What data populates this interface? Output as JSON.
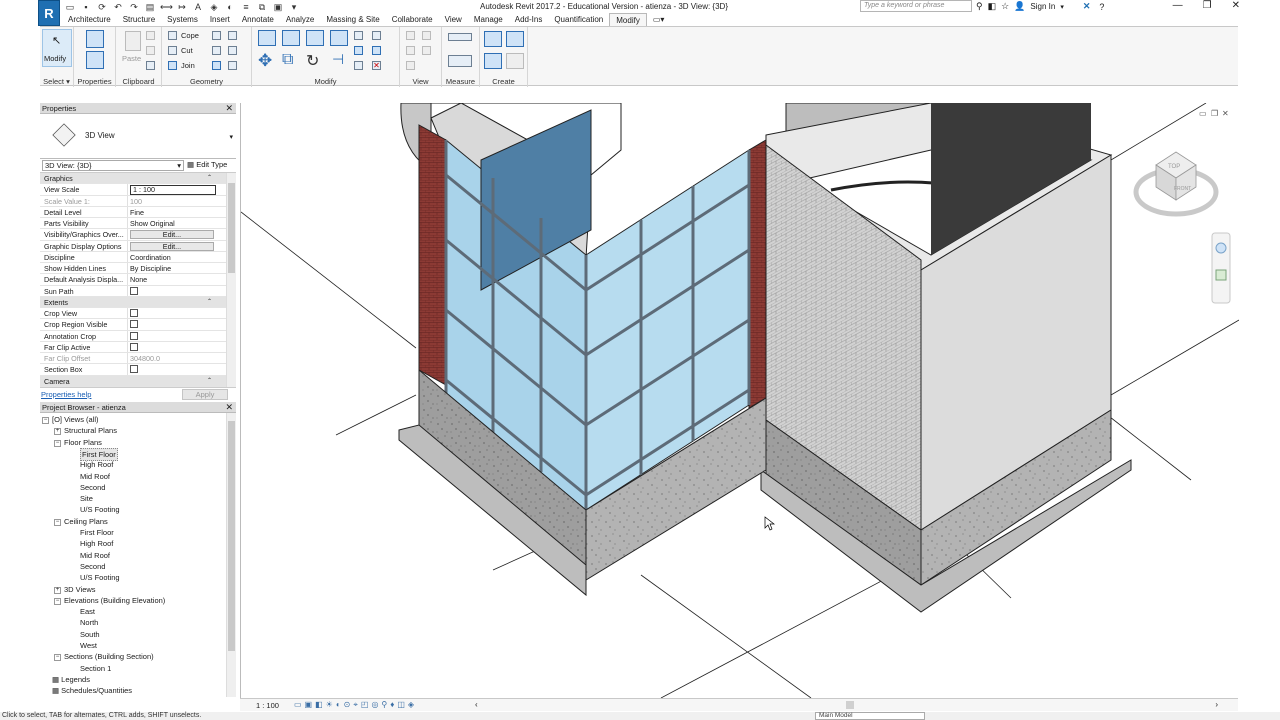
{
  "app": {
    "title": "Autodesk Revit 2017.2 - Educational Version -    atienza - 3D View: {3D}",
    "logo": "R",
    "search_placeholder": "Type a keyword or phrase",
    "sign_in": "Sign In"
  },
  "ribbon_tabs": [
    "Architecture",
    "Structure",
    "Systems",
    "Insert",
    "Annotate",
    "Analyze",
    "Massing & Site",
    "Collaborate",
    "View",
    "Manage",
    "Add-Ins",
    "Quantification",
    "Modify"
  ],
  "active_tab": "Modify",
  "ribbon": {
    "modify_label": "Modify",
    "properties_label": "Properties",
    "paste_label": "Paste",
    "cope_label": "Cope",
    "cut_label": "Cut",
    "join_label": "Join",
    "panels": {
      "select": "Select",
      "properties": "Properties",
      "clipboard": "Clipboard",
      "geometry": "Geometry",
      "modify": "Modify",
      "view": "View",
      "measure": "Measure",
      "create": "Create"
    }
  },
  "properties": {
    "header": "Properties",
    "type_name": "3D View",
    "instance_selector": "3D View: {3D}",
    "edit_type": "Edit Type",
    "help_link": "Properties help",
    "apply": "Apply",
    "rows": [
      {
        "kind": "section",
        "key": "Graphics"
      },
      {
        "kind": "value",
        "key": "View Scale",
        "value": "1 : 100",
        "boxed": true
      },
      {
        "kind": "value",
        "key": "Scale Value    1:",
        "value": "100",
        "grey": true
      },
      {
        "kind": "value",
        "key": "Detail Level",
        "value": "Fine"
      },
      {
        "kind": "value",
        "key": "Parts Visibility",
        "value": "Show Original"
      },
      {
        "kind": "button",
        "key": "Visibility/Graphics Over...",
        "value": "Edit..."
      },
      {
        "kind": "button",
        "key": "Graphic Display Options",
        "value": "Edit..."
      },
      {
        "kind": "value",
        "key": "Discipline",
        "value": "Coordination"
      },
      {
        "kind": "value",
        "key": "Show Hidden Lines",
        "value": "By Discipline"
      },
      {
        "kind": "value",
        "key": "Default Analysis Displa...",
        "value": "None"
      },
      {
        "kind": "check",
        "key": "Sun Path",
        "checked": false
      },
      {
        "kind": "section",
        "key": "Extents"
      },
      {
        "kind": "check",
        "key": "Crop View",
        "checked": false
      },
      {
        "kind": "check",
        "key": "Crop Region Visible",
        "checked": false
      },
      {
        "kind": "check",
        "key": "Annotation Crop",
        "checked": false
      },
      {
        "kind": "check",
        "key": "Far Clip Active",
        "checked": false
      },
      {
        "kind": "value",
        "key": "Far Clip Offset",
        "value": "304800.0",
        "grey": true
      },
      {
        "kind": "check",
        "key": "Section Box",
        "checked": false
      },
      {
        "kind": "section",
        "key": "Camera"
      }
    ]
  },
  "project_browser": {
    "header": "Project Browser - atienza",
    "nodes": [
      {
        "text": "Views (all)",
        "level": 0,
        "toggle": "−",
        "icon": "[O]"
      },
      {
        "text": "Structural Plans",
        "level": 1,
        "toggle": "+"
      },
      {
        "text": "Floor Plans",
        "level": 1,
        "toggle": "−"
      },
      {
        "text": "First Floor",
        "level": 2,
        "selected": true
      },
      {
        "text": "High Roof",
        "level": 2
      },
      {
        "text": "Mid Roof",
        "level": 2
      },
      {
        "text": "Second",
        "level": 2
      },
      {
        "text": "Site",
        "level": 2
      },
      {
        "text": "U/S Footing",
        "level": 2
      },
      {
        "text": "Ceiling Plans",
        "level": 1,
        "toggle": "−"
      },
      {
        "text": "First Floor",
        "level": 2
      },
      {
        "text": "High Roof",
        "level": 2
      },
      {
        "text": "Mid Roof",
        "level": 2
      },
      {
        "text": "Second",
        "level": 2
      },
      {
        "text": "U/S Footing",
        "level": 2
      },
      {
        "text": "3D Views",
        "level": 1,
        "toggle": "+"
      },
      {
        "text": "Elevations (Building Elevation)",
        "level": 1,
        "toggle": "−"
      },
      {
        "text": "East",
        "level": 2
      },
      {
        "text": "North",
        "level": 2
      },
      {
        "text": "South",
        "level": 2
      },
      {
        "text": "West",
        "level": 2
      },
      {
        "text": "Sections (Building Section)",
        "level": 1,
        "toggle": "−"
      },
      {
        "text": "Section 1",
        "level": 2
      },
      {
        "text": "Legends",
        "level": 0,
        "toggle": "",
        "icon": "▦"
      },
      {
        "text": "Schedules/Quantities",
        "level": 0,
        "toggle": "",
        "icon": "▦"
      }
    ]
  },
  "viewbar": {
    "scale": "1 : 100"
  },
  "viewcube": {
    "top": "TOP",
    "front": "FRONT"
  },
  "status": {
    "message": "Click to select, TAB for alternates, CTRL adds, SHIFT unselects.",
    "model": "Main Model"
  },
  "colors": {
    "accent": "#1f6fb2",
    "glass": "#a9d3ea",
    "brick": "#8c3a34",
    "concrete": "#9c9c9c",
    "wall": "#dcdcdc"
  }
}
